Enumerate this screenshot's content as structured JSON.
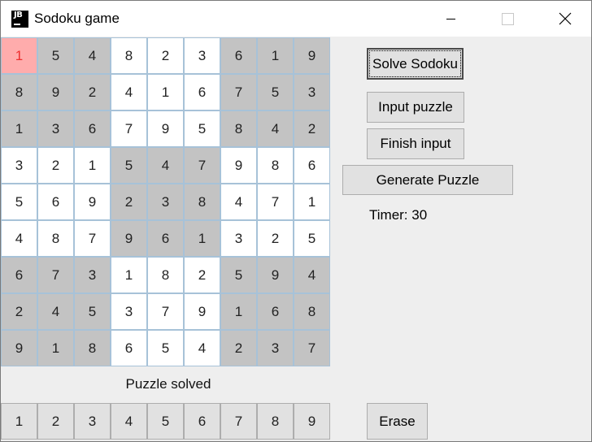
{
  "window": {
    "title": "Sodoku game",
    "app_icon": "jetbrains-logo-icon",
    "app_icon_text": "JB",
    "controls": [
      "minimize-icon",
      "maximize-icon",
      "close-icon"
    ]
  },
  "board": {
    "selected_cell": [
      0,
      0
    ],
    "rows": [
      [
        "1",
        "5",
        "4",
        "8",
        "2",
        "3",
        "6",
        "1",
        "9"
      ],
      [
        "8",
        "9",
        "2",
        "4",
        "1",
        "6",
        "7",
        "5",
        "3"
      ],
      [
        "1",
        "3",
        "6",
        "7",
        "9",
        "5",
        "8",
        "4",
        "2"
      ],
      [
        "3",
        "2",
        "1",
        "5",
        "4",
        "7",
        "9",
        "8",
        "6"
      ],
      [
        "5",
        "6",
        "9",
        "2",
        "3",
        "8",
        "4",
        "7",
        "1"
      ],
      [
        "4",
        "8",
        "7",
        "9",
        "6",
        "1",
        "3",
        "2",
        "5"
      ],
      [
        "6",
        "7",
        "3",
        "1",
        "8",
        "2",
        "5",
        "9",
        "4"
      ],
      [
        "2",
        "4",
        "5",
        "3",
        "7",
        "9",
        "1",
        "6",
        "8"
      ],
      [
        "9",
        "1",
        "8",
        "6",
        "5",
        "4",
        "2",
        "3",
        "7"
      ]
    ],
    "colors": {
      "shaded_box": "#c3c3c3",
      "plain_box": "#ffffff",
      "selected_bg": "#ffacac",
      "selected_text": "#ee2e2e",
      "cell_border": "#a7c2d8"
    }
  },
  "status": {
    "message": "Puzzle solved"
  },
  "controls": {
    "solve_label": "Solve Sodoku",
    "input_label": "Input puzzle",
    "finish_label": "Finish input",
    "generate_label": "Generate Puzzle",
    "timer_text": "Timer: 30",
    "erase_label": "Erase"
  },
  "numpad": {
    "keys": [
      "1",
      "2",
      "3",
      "4",
      "5",
      "6",
      "7",
      "8",
      "9"
    ]
  }
}
